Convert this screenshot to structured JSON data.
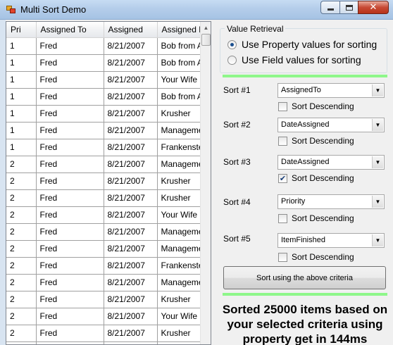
{
  "window": {
    "title": "Multi Sort Demo"
  },
  "grid": {
    "columns": [
      "Pri",
      "Assigned To",
      "Assigned",
      "Assigned By"
    ],
    "rows": [
      [
        "1",
        "Fred",
        "8/21/2007",
        "Bob from Acc"
      ],
      [
        "1",
        "Fred",
        "8/21/2007",
        "Bob from Acc"
      ],
      [
        "1",
        "Fred",
        "8/21/2007",
        "Your Wife"
      ],
      [
        "1",
        "Fred",
        "8/21/2007",
        "Bob from Acc"
      ],
      [
        "1",
        "Fred",
        "8/21/2007",
        "Krusher"
      ],
      [
        "1",
        "Fred",
        "8/21/2007",
        "Management"
      ],
      [
        "1",
        "Fred",
        "8/21/2007",
        "Frankenstein"
      ],
      [
        "2",
        "Fred",
        "8/21/2007",
        "Management"
      ],
      [
        "2",
        "Fred",
        "8/21/2007",
        "Krusher"
      ],
      [
        "2",
        "Fred",
        "8/21/2007",
        "Krusher"
      ],
      [
        "2",
        "Fred",
        "8/21/2007",
        "Your Wife"
      ],
      [
        "2",
        "Fred",
        "8/21/2007",
        "Management"
      ],
      [
        "2",
        "Fred",
        "8/21/2007",
        "Management"
      ],
      [
        "2",
        "Fred",
        "8/21/2007",
        "Frankenstein"
      ],
      [
        "2",
        "Fred",
        "8/21/2007",
        "Management"
      ],
      [
        "2",
        "Fred",
        "8/21/2007",
        "Krusher"
      ],
      [
        "2",
        "Fred",
        "8/21/2007",
        "Your Wife"
      ],
      [
        "2",
        "Fred",
        "8/21/2007",
        "Krusher"
      ],
      [
        "2",
        "Fred",
        "8/21/2007",
        ""
      ]
    ]
  },
  "retrieval": {
    "legend": "Value Retrieval",
    "property_label": "Use Property values for sorting",
    "field_label": "Use Field values for sorting",
    "selected": "property"
  },
  "sorts": [
    {
      "label": "Sort #1",
      "value": "AssignedTo",
      "descending_label": "Sort Descending",
      "descending": false
    },
    {
      "label": "Sort #2",
      "value": "DateAssigned",
      "descending_label": "Sort Descending",
      "descending": false
    },
    {
      "label": "Sort #3",
      "value": "DateAssigned",
      "descending_label": "Sort Descending",
      "descending": true
    },
    {
      "label": "Sort #4",
      "value": "Priority",
      "descending_label": "Sort Descending",
      "descending": false
    },
    {
      "label": "Sort #5",
      "value": "ItemFinished",
      "descending_label": "Sort Descending",
      "descending": false
    }
  ],
  "sort_button_label": "Sort using the above criteria",
  "result_text": "Sorted 25000 items based on your selected criteria using property get in 144ms",
  "colors": {
    "green_bar": "#8ef78a",
    "window_frame": "#b4cdea"
  },
  "icons": [
    "app-icon",
    "minimize-icon",
    "maximize-icon",
    "close-icon",
    "dropdown-arrow-icon",
    "scroll-up-arrow-icon"
  ]
}
